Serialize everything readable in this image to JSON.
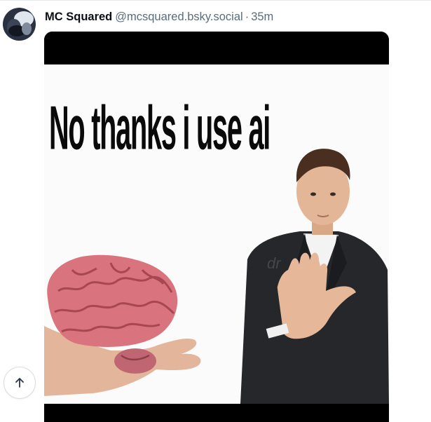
{
  "post": {
    "author_name": "MC Squared",
    "author_handle": "@mcsquared.bsky.social",
    "separator": "·",
    "timestamp": "35m",
    "image": {
      "caption_text": "No thanks i use ai",
      "watermark_text": "dr"
    }
  },
  "controls": {
    "scroll_top_icon": "arrow-up-icon"
  },
  "colors": {
    "handle_gray": "#5b6b7c",
    "name_black": "#0b0f14",
    "brain_pink": "#d9747e"
  }
}
